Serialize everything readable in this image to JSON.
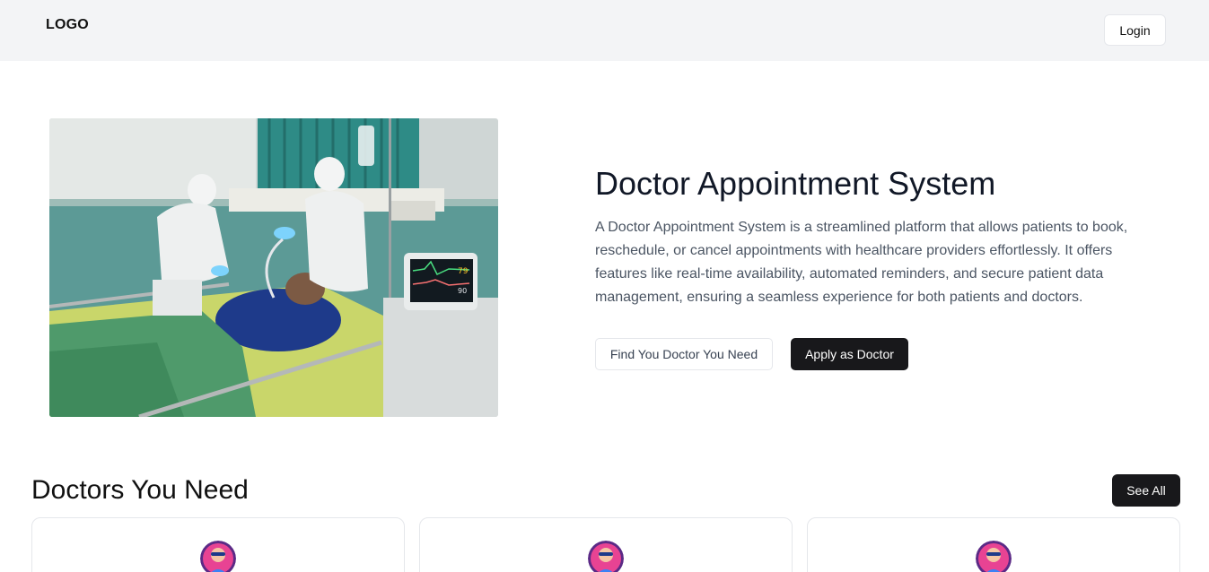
{
  "header": {
    "logo_text": "LOGO",
    "login_label": "Login"
  },
  "hero": {
    "image_alt": "Medical staff in protective suits attending a patient in a hospital bed",
    "title": "Doctor Appointment System",
    "description": "A Doctor Appointment System is a streamlined platform that allows patients to book, reschedule, or cancel appointments with healthcare providers effortlessly. It offers features like real-time availability, automated reminders, and secure patient data management, ensuring a seamless experience for both patients and doctors.",
    "find_doctor_label": "Find You Doctor You Need",
    "apply_doctor_label": "Apply as Doctor"
  },
  "doctors_section": {
    "title": "Doctors You Need",
    "see_all_label": "See All",
    "cards": [
      {
        "avatar": "doctor-avatar"
      },
      {
        "avatar": "doctor-avatar"
      },
      {
        "avatar": "doctor-avatar"
      }
    ]
  },
  "colors": {
    "navbar_bg": "#f3f4f6",
    "primary_dark": "#18181b",
    "text_muted": "#4b5563",
    "border": "#e5e7eb"
  }
}
